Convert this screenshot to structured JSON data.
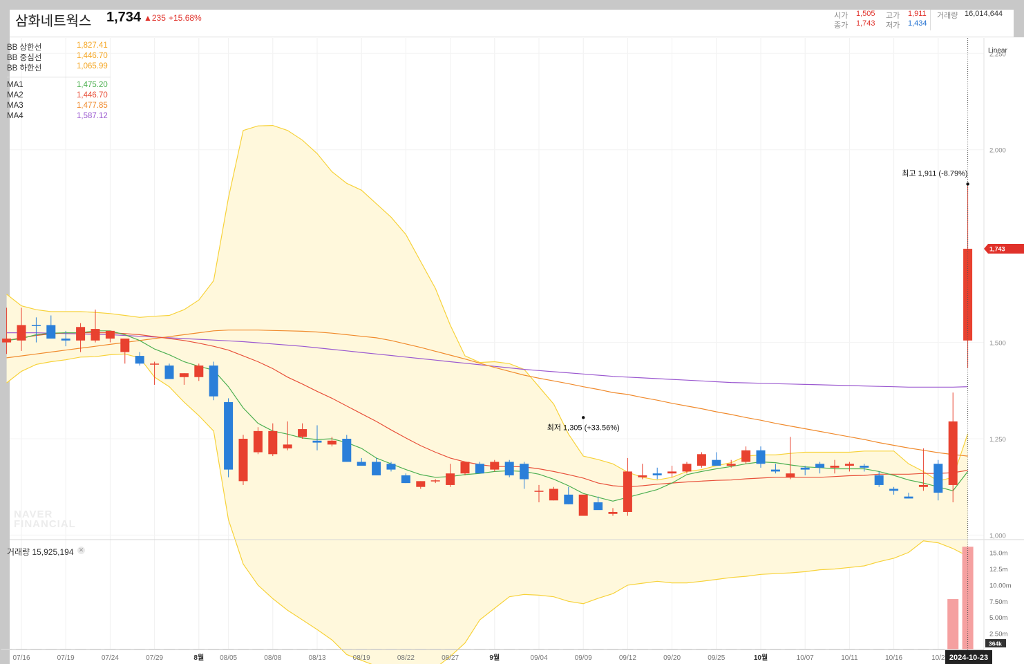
{
  "header": {
    "name": "삼화네트웍스",
    "price": "1,734",
    "change": "▲235",
    "change_pct": "+15.68%",
    "open_label": "시가",
    "open": "1,505",
    "high_label": "고가",
    "high": "1,911",
    "volume_label": "거래량",
    "volume": "16,014,644",
    "close_label": "종가",
    "close": "1,743",
    "low_label": "저가",
    "low": "1,434"
  },
  "legend": {
    "bb": [
      {
        "name": "BB 상한선",
        "value": "1,827.41",
        "color": "#f5a623"
      },
      {
        "name": "BB 중심선",
        "value": "1,446.70",
        "color": "#f5a623"
      },
      {
        "name": "BB 하한선",
        "value": "1,065.99",
        "color": "#f5a623"
      }
    ],
    "ma": [
      {
        "name": "MA1",
        "value": "1,475.20",
        "color": "#4caf50"
      },
      {
        "name": "MA2",
        "value": "1,446.70",
        "color": "#e8503a"
      },
      {
        "name": "MA3",
        "value": "1,477.85",
        "color": "#f08a2c"
      },
      {
        "name": "MA4",
        "value": "1,587.12",
        "color": "#9b59d0"
      }
    ]
  },
  "volume_panel": {
    "title": "거래량 15,925,194",
    "close_icon": "close-icon",
    "last_label": "364k"
  },
  "scale_mode": "Linear",
  "watermark": [
    "NAVER",
    "FINANCIAL"
  ],
  "colors": {
    "up": "#e8412f",
    "down": "#2a7fd9",
    "bb_fill": "#fff8dc",
    "bb_line": "#f7d23a",
    "vol_up": "#f5a0a0"
  },
  "chart_data": {
    "type": "candlestick",
    "price_axis": {
      "ticks": [
        1000,
        1250,
        1500,
        2000,
        2250
      ],
      "tick_labels": [
        "1,000",
        "1,250",
        "1,500",
        "2,000",
        "2,250"
      ],
      "range": [
        990,
        2290
      ]
    },
    "volume_axis": {
      "ticks": [
        2.5,
        5,
        7.5,
        10,
        12.5,
        15
      ],
      "tick_labels": [
        "2.50m",
        "5.00m",
        "7.50m",
        "10.00m",
        "12.5m",
        "15.0m"
      ],
      "range": [
        0,
        17
      ]
    },
    "x_labels": [
      "07/16",
      "07/19",
      "07/24",
      "07/29",
      "8월",
      "08/05",
      "08/08",
      "08/13",
      "08/19",
      "08/22",
      "08/27",
      "9월",
      "09/04",
      "09/09",
      "09/12",
      "09/20",
      "09/25",
      "10월",
      "10/07",
      "10/11",
      "10/16",
      "10/2"
    ],
    "x_label_index": [
      1,
      4,
      7,
      10,
      13,
      15,
      18,
      21,
      24,
      27,
      30,
      33,
      36,
      39,
      42,
      45,
      48,
      51,
      54,
      57,
      60,
      63
    ],
    "current_date": "2024-10-23",
    "current_price_tag": "1,743",
    "annotations": [
      {
        "text": "최고 1,911 (-8.79%)",
        "index": 65,
        "value": 1911,
        "where": "above"
      },
      {
        "text": "최저 1,305 (+33.56%)",
        "index": 39,
        "value": 1305,
        "where": "below"
      }
    ],
    "candles": [
      {
        "o": 1500,
        "h": 1590,
        "l": 1470,
        "c": 1510
      },
      {
        "o": 1505,
        "h": 1590,
        "l": 1478,
        "c": 1545
      },
      {
        "o": 1545,
        "h": 1565,
        "l": 1500,
        "c": 1543
      },
      {
        "o": 1545,
        "h": 1570,
        "l": 1510,
        "c": 1510
      },
      {
        "o": 1510,
        "h": 1530,
        "l": 1490,
        "c": 1505
      },
      {
        "o": 1505,
        "h": 1550,
        "l": 1475,
        "c": 1540
      },
      {
        "o": 1505,
        "h": 1585,
        "l": 1500,
        "c": 1535
      },
      {
        "o": 1510,
        "h": 1530,
        "l": 1500,
        "c": 1530
      },
      {
        "o": 1475,
        "h": 1510,
        "l": 1445,
        "c": 1510
      },
      {
        "o": 1465,
        "h": 1475,
        "l": 1440,
        "c": 1445
      },
      {
        "o": 1445,
        "h": 1450,
        "l": 1390,
        "c": 1445
      },
      {
        "o": 1440,
        "h": 1445,
        "l": 1405,
        "c": 1405
      },
      {
        "o": 1410,
        "h": 1420,
        "l": 1390,
        "c": 1420
      },
      {
        "o": 1410,
        "h": 1445,
        "l": 1400,
        "c": 1440
      },
      {
        "o": 1440,
        "h": 1450,
        "l": 1350,
        "c": 1360
      },
      {
        "o": 1345,
        "h": 1355,
        "l": 1150,
        "c": 1170
      },
      {
        "o": 1140,
        "h": 1260,
        "l": 1130,
        "c": 1250
      },
      {
        "o": 1215,
        "h": 1280,
        "l": 1210,
        "c": 1270
      },
      {
        "o": 1210,
        "h": 1290,
        "l": 1205,
        "c": 1270
      },
      {
        "o": 1225,
        "h": 1295,
        "l": 1220,
        "c": 1235
      },
      {
        "o": 1255,
        "h": 1290,
        "l": 1250,
        "c": 1275
      },
      {
        "o": 1245,
        "h": 1285,
        "l": 1220,
        "c": 1240
      },
      {
        "o": 1235,
        "h": 1255,
        "l": 1230,
        "c": 1245
      },
      {
        "o": 1250,
        "h": 1260,
        "l": 1190,
        "c": 1190
      },
      {
        "o": 1190,
        "h": 1200,
        "l": 1180,
        "c": 1180
      },
      {
        "o": 1190,
        "h": 1200,
        "l": 1155,
        "c": 1155
      },
      {
        "o": 1185,
        "h": 1190,
        "l": 1165,
        "c": 1170
      },
      {
        "o": 1155,
        "h": 1160,
        "l": 1135,
        "c": 1135
      },
      {
        "o": 1125,
        "h": 1140,
        "l": 1120,
        "c": 1140
      },
      {
        "o": 1140,
        "h": 1145,
        "l": 1135,
        "c": 1142
      },
      {
        "o": 1130,
        "h": 1185,
        "l": 1125,
        "c": 1160
      },
      {
        "o": 1160,
        "h": 1190,
        "l": 1155,
        "c": 1190
      },
      {
        "o": 1185,
        "h": 1190,
        "l": 1160,
        "c": 1160
      },
      {
        "o": 1170,
        "h": 1195,
        "l": 1165,
        "c": 1190
      },
      {
        "o": 1190,
        "h": 1195,
        "l": 1150,
        "c": 1155
      },
      {
        "o": 1185,
        "h": 1190,
        "l": 1120,
        "c": 1145
      },
      {
        "o": 1115,
        "h": 1130,
        "l": 1085,
        "c": 1115
      },
      {
        "o": 1090,
        "h": 1125,
        "l": 1090,
        "c": 1120
      },
      {
        "o": 1105,
        "h": 1125,
        "l": 1080,
        "c": 1080
      },
      {
        "o": 1050,
        "h": 1105,
        "l": 1050,
        "c": 1105
      },
      {
        "o": 1085,
        "h": 1100,
        "l": 1070,
        "c": 1065
      },
      {
        "o": 1055,
        "h": 1070,
        "l": 1050,
        "c": 1060
      },
      {
        "o": 1060,
        "h": 1200,
        "l": 1050,
        "c": 1165
      },
      {
        "o": 1150,
        "h": 1185,
        "l": 1145,
        "c": 1155
      },
      {
        "o": 1160,
        "h": 1175,
        "l": 1145,
        "c": 1155
      },
      {
        "o": 1160,
        "h": 1180,
        "l": 1150,
        "c": 1165
      },
      {
        "o": 1165,
        "h": 1190,
        "l": 1160,
        "c": 1185
      },
      {
        "o": 1180,
        "h": 1215,
        "l": 1175,
        "c": 1210
      },
      {
        "o": 1195,
        "h": 1215,
        "l": 1180,
        "c": 1180
      },
      {
        "o": 1180,
        "h": 1195,
        "l": 1175,
        "c": 1185
      },
      {
        "o": 1190,
        "h": 1230,
        "l": 1185,
        "c": 1220
      },
      {
        "o": 1220,
        "h": 1230,
        "l": 1175,
        "c": 1185
      },
      {
        "o": 1170,
        "h": 1185,
        "l": 1160,
        "c": 1165
      },
      {
        "o": 1150,
        "h": 1255,
        "l": 1145,
        "c": 1160
      },
      {
        "o": 1175,
        "h": 1180,
        "l": 1155,
        "c": 1170
      },
      {
        "o": 1185,
        "h": 1190,
        "l": 1160,
        "c": 1175
      },
      {
        "o": 1175,
        "h": 1195,
        "l": 1160,
        "c": 1180
      },
      {
        "o": 1180,
        "h": 1190,
        "l": 1165,
        "c": 1185
      },
      {
        "o": 1180,
        "h": 1185,
        "l": 1165,
        "c": 1175
      },
      {
        "o": 1155,
        "h": 1165,
        "l": 1125,
        "c": 1130
      },
      {
        "o": 1120,
        "h": 1125,
        "l": 1105,
        "c": 1115
      },
      {
        "o": 1100,
        "h": 1110,
        "l": 1095,
        "c": 1095
      },
      {
        "o": 1125,
        "h": 1225,
        "l": 1115,
        "c": 1130
      },
      {
        "o": 1185,
        "h": 1195,
        "l": 1090,
        "c": 1110
      },
      {
        "o": 1130,
        "h": 1370,
        "l": 1085,
        "c": 1295
      },
      {
        "o": 1505,
        "h": 1911,
        "l": 1434,
        "c": 1743
      }
    ],
    "volumes": [
      0.1,
      0.1,
      0.1,
      0.1,
      0.1,
      0.1,
      0.1,
      0.1,
      0.1,
      0.1,
      0.1,
      0.1,
      0.1,
      0.1,
      0.1,
      0.1,
      0.1,
      0.1,
      0.1,
      0.1,
      0.1,
      0.1,
      0.1,
      0.1,
      0.1,
      0.1,
      0.1,
      0.1,
      0.1,
      0.1,
      0.1,
      0.1,
      0.1,
      0.1,
      0.1,
      0.1,
      0.1,
      0.1,
      0.1,
      0.1,
      0.1,
      0.1,
      0.1,
      0.1,
      0.1,
      0.1,
      0.1,
      0.1,
      0.1,
      0.1,
      0.1,
      0.1,
      0.1,
      0.1,
      0.1,
      0.1,
      0.1,
      0.1,
      0.1,
      0.1,
      0.1,
      0.1,
      0.1,
      0.1,
      7.8,
      15.9
    ],
    "ma1": [
      1505,
      1510,
      1520,
      1524,
      1525,
      1525,
      1530,
      1530,
      1520,
      1505,
      1483,
      1468,
      1450,
      1438,
      1428,
      1385,
      1330,
      1290,
      1270,
      1262,
      1252,
      1248,
      1250,
      1240,
      1225,
      1200,
      1185,
      1170,
      1157,
      1150,
      1152,
      1157,
      1160,
      1165,
      1167,
      1165,
      1158,
      1145,
      1128,
      1108,
      1098,
      1088,
      1098,
      1108,
      1118,
      1135,
      1157,
      1165,
      1172,
      1178,
      1185,
      1190,
      1188,
      1182,
      1177,
      1175,
      1172,
      1172,
      1172,
      1165,
      1155,
      1143,
      1135,
      1125,
      1115,
      1165
    ],
    "ma2": [
      1505,
      1512,
      1518,
      1522,
      1525,
      1525,
      1525,
      1525,
      1523,
      1520,
      1515,
      1510,
      1505,
      1498,
      1490,
      1480,
      1465,
      1450,
      1432,
      1410,
      1392,
      1373,
      1355,
      1335,
      1315,
      1295,
      1273,
      1252,
      1232,
      1215,
      1200,
      1190,
      1183,
      1178,
      1178,
      1177,
      1172,
      1165,
      1157,
      1148,
      1135,
      1128,
      1125,
      1128,
      1132,
      1135,
      1138,
      1140,
      1142,
      1143,
      1146,
      1148,
      1150,
      1150,
      1150,
      1150,
      1152,
      1154,
      1155,
      1158,
      1158,
      1158,
      1160,
      1160,
      1162,
      1168
    ],
    "ma3": [
      1460,
      1465,
      1470,
      1475,
      1480,
      1485,
      1490,
      1495,
      1500,
      1505,
      1510,
      1515,
      1520,
      1525,
      1530,
      1532,
      1532,
      1532,
      1531,
      1530,
      1529,
      1527,
      1524,
      1520,
      1516,
      1512,
      1505,
      1496,
      1487,
      1477,
      1467,
      1457,
      1446,
      1435,
      1425,
      1415,
      1407,
      1400,
      1393,
      1385,
      1378,
      1370,
      1365,
      1357,
      1350,
      1342,
      1335,
      1328,
      1320,
      1313,
      1305,
      1298,
      1290,
      1283,
      1276,
      1269,
      1262,
      1255,
      1248,
      1240,
      1233,
      1226,
      1220,
      1214,
      1209,
      1205
    ],
    "ma4": [
      1525,
      1525,
      1525,
      1524,
      1523,
      1522,
      1521,
      1520,
      1518,
      1516,
      1514,
      1512,
      1510,
      1508,
      1506,
      1504,
      1502,
      1499,
      1496,
      1493,
      1490,
      1486,
      1482,
      1478,
      1474,
      1470,
      1466,
      1462,
      1458,
      1454,
      1450,
      1446,
      1442,
      1438,
      1434,
      1430,
      1427,
      1424,
      1421,
      1418,
      1415,
      1412,
      1410,
      1408,
      1406,
      1404,
      1402,
      1400,
      1398,
      1396,
      1395,
      1394,
      1393,
      1392,
      1391,
      1390,
      1389,
      1388,
      1387,
      1386,
      1385,
      1384,
      1384,
      1384,
      1384,
      1385
    ],
    "bb_upper": [
      1625,
      1595,
      1585,
      1580,
      1580,
      1580,
      1578,
      1575,
      1570,
      1565,
      1568,
      1570,
      1585,
      1610,
      1660,
      1875,
      2050,
      2062,
      2063,
      2050,
      2025,
      1990,
      1943,
      1913,
      1895,
      1860,
      1825,
      1780,
      1710,
      1640,
      1545,
      1465,
      1448,
      1450,
      1445,
      1430,
      1385,
      1340,
      1262,
      1205,
      1196,
      1185,
      1163,
      1150,
      1143,
      1150,
      1165,
      1170,
      1180,
      1188,
      1205,
      1208,
      1208,
      1212,
      1215,
      1215,
      1215,
      1215,
      1218,
      1218,
      1218,
      1185,
      1165,
      1140,
      1150,
      1263
    ],
    "bb_lower": [
      1395,
      1425,
      1443,
      1450,
      1455,
      1462,
      1463,
      1468,
      1470,
      1460,
      1410,
      1385,
      1345,
      1310,
      1270,
      1040,
      925,
      870,
      835,
      805,
      780,
      755,
      728,
      690,
      675,
      660,
      645,
      640,
      640,
      655,
      685,
      720,
      780,
      810,
      840,
      846,
      844,
      840,
      828,
      822,
      836,
      848,
      870,
      875,
      880,
      876,
      876,
      880,
      885,
      890,
      893,
      898,
      900,
      902,
      905,
      910,
      912,
      916,
      920,
      931,
      940,
      955,
      985,
      980,
      965,
      945
    ]
  }
}
